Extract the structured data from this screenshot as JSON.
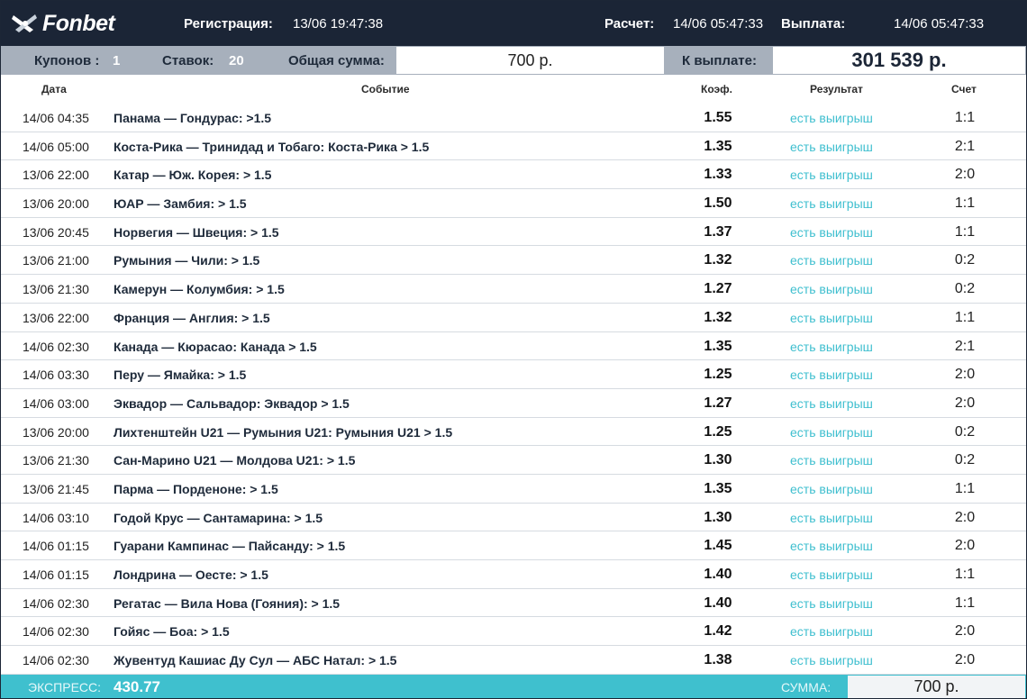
{
  "header": {
    "logo_text": "Fonbet",
    "registration_label": "Регистрация:",
    "registration_value": "13/06  19:47:38",
    "settlement_label": "Расчет:",
    "settlement_value": "14/06  05:47:33",
    "payout_label": "Выплата:",
    "payout_value": "14/06 05:47:33"
  },
  "summary": {
    "coupons_label": "Купонов :",
    "coupons_value": "1",
    "bets_label": "Ставок:",
    "bets_value": "20",
    "total_label": "Общая сумма:",
    "total_value": "700 р.",
    "payout_label": "К выплате:",
    "payout_value": "301 539 р."
  },
  "columns": {
    "date": "Дата",
    "event": "Событие",
    "coef": "Коэф.",
    "result": "Результат",
    "score": "Счет"
  },
  "rows": [
    {
      "date": "14/06 04:35",
      "event": "Панама — Гондурас: >1.5",
      "coef": "1.55",
      "result": "есть выигрыш",
      "score": "1:1"
    },
    {
      "date": "14/06 05:00",
      "event": "Коста-Рика — Тринидад и Тобаго: Коста-Рика > 1.5",
      "coef": "1.35",
      "result": "есть выигрыш",
      "score": "2:1"
    },
    {
      "date": "13/06 22:00",
      "event": "Катар — Юж. Корея: > 1.5",
      "coef": "1.33",
      "result": "есть выигрыш",
      "score": "2:0"
    },
    {
      "date": "13/06 20:00",
      "event": "ЮАР — Замбия: > 1.5",
      "coef": "1.50",
      "result": "есть выигрыш",
      "score": "1:1"
    },
    {
      "date": "13/06 20:45",
      "event": "Норвегия — Швеция: > 1.5",
      "coef": "1.37",
      "result": "есть выигрыш",
      "score": "1:1"
    },
    {
      "date": "13/06 21:00",
      "event": "Румыния — Чили: > 1.5",
      "coef": "1.32",
      "result": "есть выигрыш",
      "score": "0:2"
    },
    {
      "date": "13/06 21:30",
      "event": "Камерун — Колумбия: > 1.5",
      "coef": "1.27",
      "result": "есть выигрыш",
      "score": "0:2"
    },
    {
      "date": "13/06 22:00",
      "event": "Франция — Англия: > 1.5",
      "coef": "1.32",
      "result": "есть выигрыш",
      "score": "1:1"
    },
    {
      "date": "14/06 02:30",
      "event": "Канада — Кюрасао: Канада > 1.5",
      "coef": "1.35",
      "result": "есть выигрыш",
      "score": "2:1"
    },
    {
      "date": "14/06 03:30",
      "event": "Перу — Ямайка: > 1.5",
      "coef": "1.25",
      "result": "есть выигрыш",
      "score": "2:0"
    },
    {
      "date": "14/06 03:00",
      "event": "Эквадор — Сальвадор: Эквадор > 1.5",
      "coef": "1.27",
      "result": "есть выигрыш",
      "score": "2:0"
    },
    {
      "date": "13/06 20:00",
      "event": "Лихтенштейн U21 — Румыния U21: Румыния U21 > 1.5",
      "coef": "1.25",
      "result": "есть выигрыш",
      "score": "0:2"
    },
    {
      "date": "13/06 21:30",
      "event": "Сан-Марино U21 — Молдова U21: > 1.5",
      "coef": "1.30",
      "result": "есть выигрыш",
      "score": "0:2"
    },
    {
      "date": "13/06 21:45",
      "event": "Парма — Порденоне: > 1.5",
      "coef": "1.35",
      "result": "есть выигрыш",
      "score": "1:1"
    },
    {
      "date": "14/06 03:10",
      "event": "Годой Крус — Сантамарина: > 1.5",
      "coef": "1.30",
      "result": "есть выигрыш",
      "score": "2:0"
    },
    {
      "date": "14/06 01:15",
      "event": "Гуарани Кампинас — Пайсанду: > 1.5",
      "coef": "1.45",
      "result": "есть выигрыш",
      "score": "2:0"
    },
    {
      "date": "14/06 01:15",
      "event": "Лондрина — Оесте: > 1.5",
      "coef": "1.40",
      "result": "есть выигрыш",
      "score": "1:1"
    },
    {
      "date": "14/06 02:30",
      "event": "Регатас — Вила Нова (Гояния): > 1.5",
      "coef": "1.40",
      "result": "есть выигрыш",
      "score": "1:1"
    },
    {
      "date": "14/06 02:30",
      "event": "Гойяс — Боа: > 1.5",
      "coef": "1.42",
      "result": "есть выигрыш",
      "score": "2:0"
    },
    {
      "date": "14/06 02:30",
      "event": "Жувентуд Кашиас Ду Сул — АБС Натал: > 1.5",
      "coef": "1.38",
      "result": "есть выигрыш",
      "score": "2:0"
    }
  ],
  "footer": {
    "express_label": "ЭКСПРЕСС:",
    "express_value": "430.77",
    "sum_label": "СУММА:",
    "sum_value": "700 р."
  },
  "colors": {
    "header_bg": "#1b2536",
    "summary_bg": "#a7b0bc",
    "win_text": "#3fbfcf",
    "footer_bg": "#3fc0ce"
  },
  "icons": {
    "logo": "fonbet-logo-icon"
  }
}
